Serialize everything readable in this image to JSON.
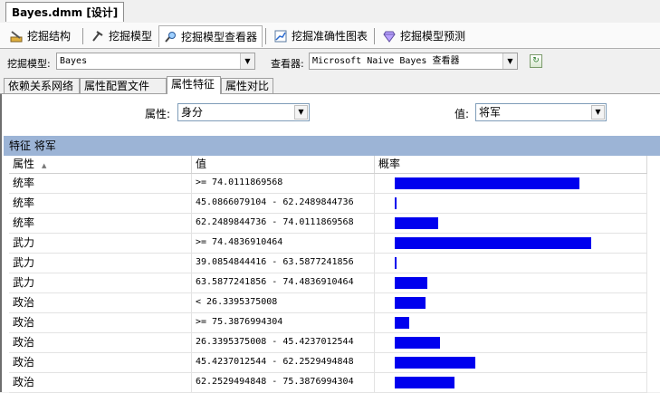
{
  "document_tab": {
    "title": "Bayes.dmm [设计]"
  },
  "designer_tabs": [
    {
      "label": "挖掘结构",
      "icon": "mining-structure-icon"
    },
    {
      "label": "挖掘模型",
      "icon": "mining-model-icon"
    },
    {
      "label": "挖掘模型查看器",
      "icon": "mining-viewer-icon",
      "active": true
    },
    {
      "label": "挖掘准确性图表",
      "icon": "accuracy-chart-icon"
    },
    {
      "label": "挖掘模型预测",
      "icon": "prediction-gem-icon"
    }
  ],
  "toolbar": {
    "model_label": "挖掘模型:",
    "model_value": "Bayes",
    "viewer_label": "查看器:",
    "viewer_value": "Microsoft Naive Bayes 查看器"
  },
  "sub_tabs": [
    {
      "label": "依赖关系网络"
    },
    {
      "label": "属性配置文件"
    },
    {
      "label": "属性特征",
      "active": true
    },
    {
      "label": "属性对比"
    }
  ],
  "filters": {
    "attribute_label": "属性:",
    "attribute_value": "身分",
    "value_label": "值:",
    "value_value": "将军"
  },
  "section_header": "特征 将军",
  "grid": {
    "columns": [
      "属性",
      "值",
      "概率"
    ],
    "rows": [
      {
        "attr": "统率",
        "value": ">= 74.0111869568",
        "prob": 0.94
      },
      {
        "attr": "统率",
        "value": "45.0866079104 - 62.2489844736",
        "prob": 0.01
      },
      {
        "attr": "统率",
        "value": "62.2489844736 - 74.0111869568",
        "prob": 0.22
      },
      {
        "attr": "武力",
        "value": ">= 74.4836910464",
        "prob": 1.0
      },
      {
        "attr": "武力",
        "value": "39.0854844416 - 63.5877241856",
        "prob": 0.01
      },
      {
        "attr": "武力",
        "value": "63.5877241856 - 74.4836910464",
        "prob": 0.165
      },
      {
        "attr": "政治",
        "value": "< 26.3395375008",
        "prob": 0.155
      },
      {
        "attr": "政治",
        "value": ">= 75.3876994304",
        "prob": 0.075
      },
      {
        "attr": "政治",
        "value": "26.3395375008 - 45.4237012544",
        "prob": 0.23
      },
      {
        "attr": "政治",
        "value": "45.4237012544 - 62.2529494848",
        "prob": 0.41
      },
      {
        "attr": "政治",
        "value": "62.2529494848 - 75.3876994304",
        "prob": 0.305
      }
    ]
  },
  "colors": {
    "bar": "#0000ee",
    "section_header": "#9cb4d6"
  }
}
